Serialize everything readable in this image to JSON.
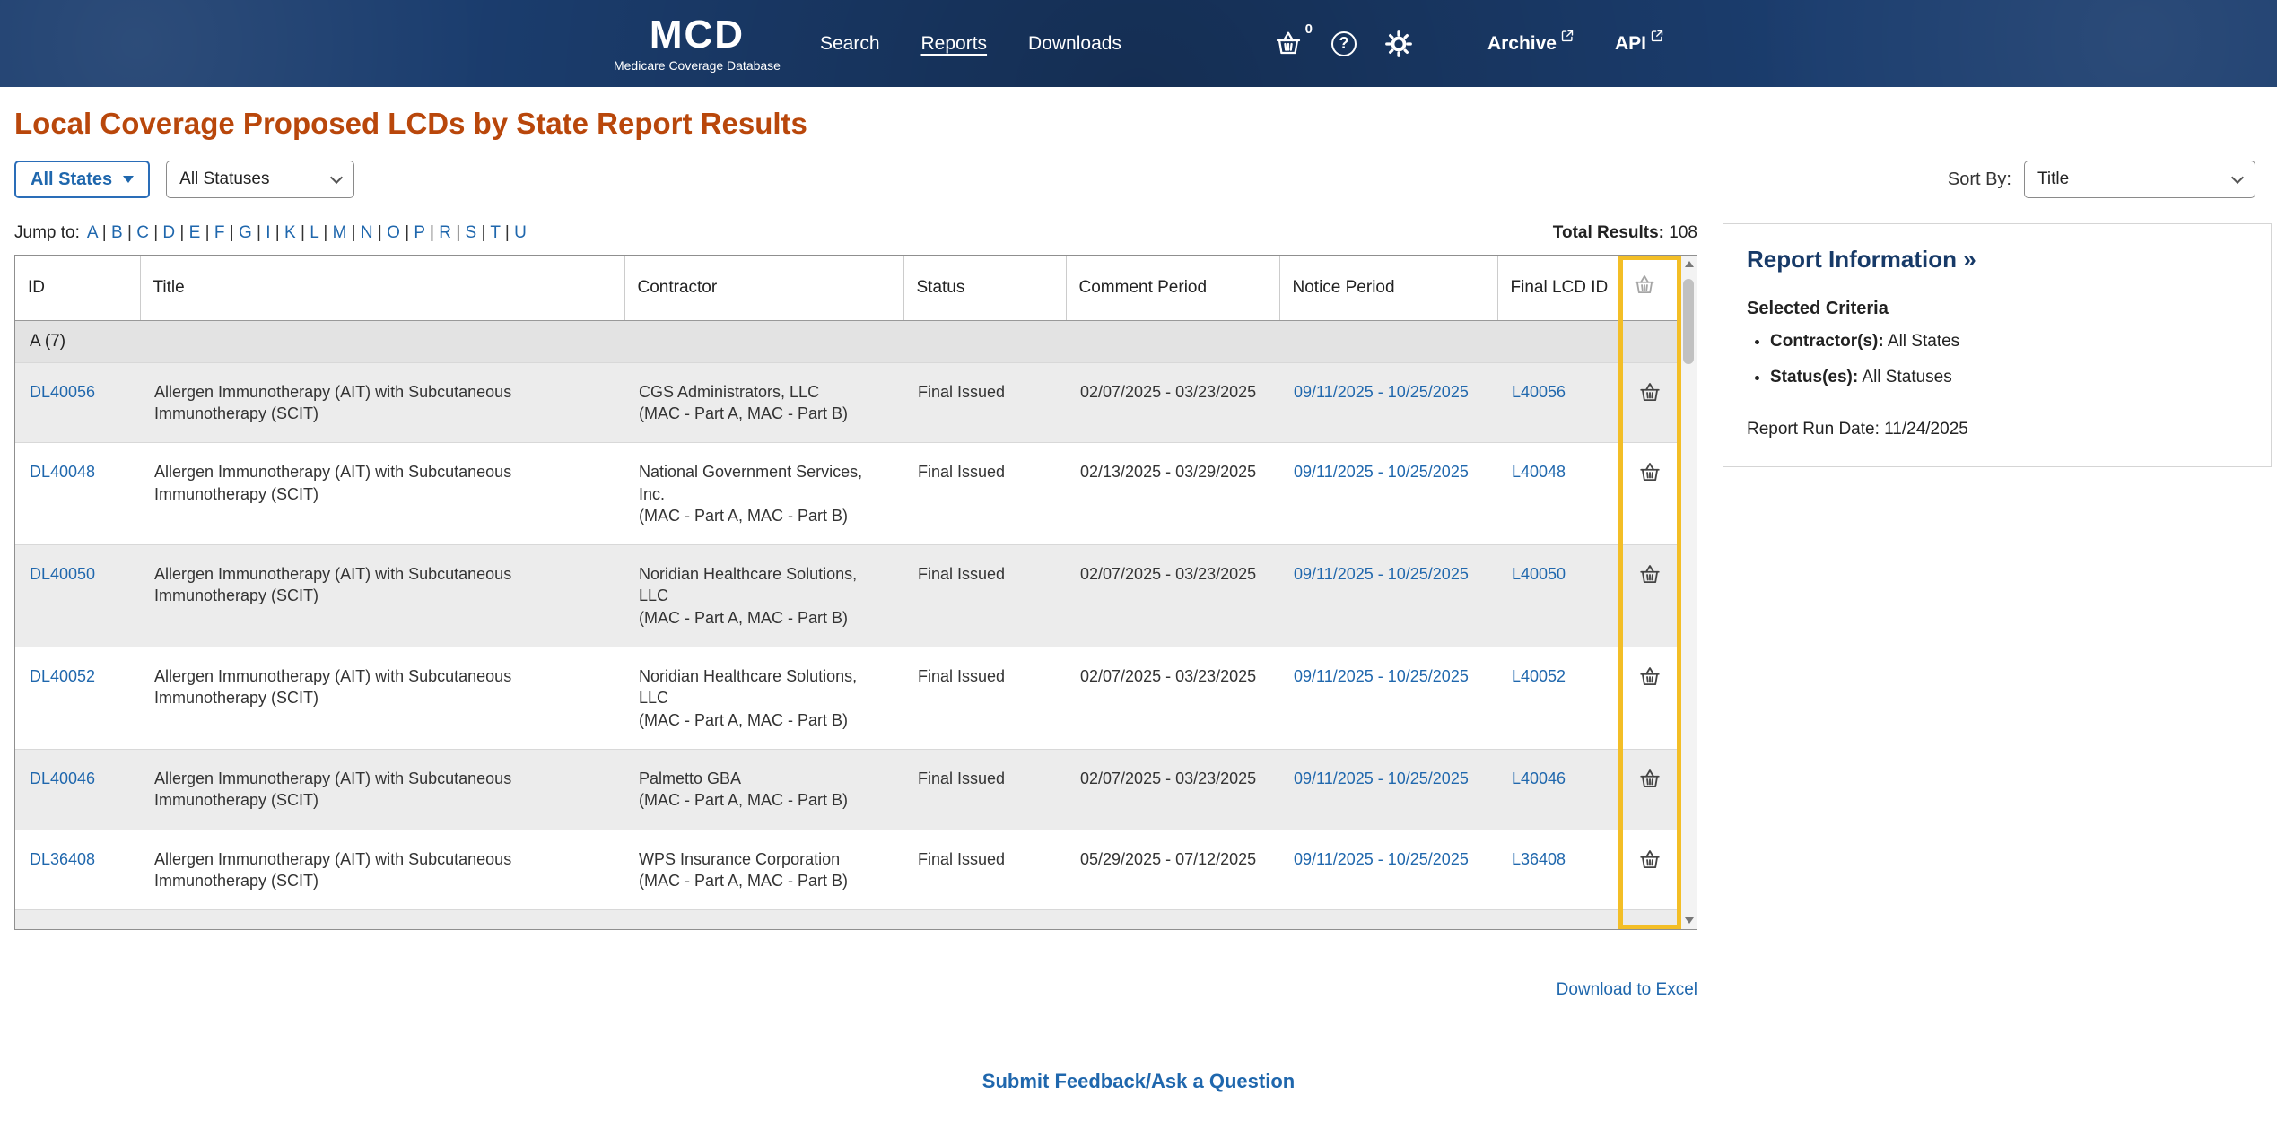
{
  "colors": {
    "header": "#1b3d6e",
    "title": "#b9470b",
    "link": "#1f67ad",
    "highlight": "#f3be26"
  },
  "icons": {
    "help": "?"
  },
  "header": {
    "logo_title": "MCD",
    "logo_subtitle": "Medicare Coverage Database",
    "nav": {
      "search": "Search",
      "reports": "Reports",
      "downloads": "Downloads"
    },
    "basket_count": "0",
    "archive": "Archive",
    "api": "API"
  },
  "page_title": "Local Coverage Proposed LCDs by State Report Results",
  "filters": {
    "states": "All States",
    "statuses": "All Statuses",
    "sort_by_label": "Sort By:",
    "sort_by_value": "Title"
  },
  "jump": {
    "label": "Jump to:",
    "letters": [
      "A",
      "B",
      "C",
      "D",
      "E",
      "F",
      "G",
      "I",
      "K",
      "L",
      "M",
      "N",
      "O",
      "P",
      "R",
      "S",
      "T",
      "U"
    ]
  },
  "totals": {
    "label": "Total Results:",
    "value": "108"
  },
  "table": {
    "headers": {
      "id": "ID",
      "title": "Title",
      "contractor": "Contractor",
      "status": "Status",
      "comment": "Comment Period",
      "notice": "Notice Period",
      "final": "Final LCD ID"
    },
    "group": "A (7)",
    "rows": [
      {
        "id": "DL40056",
        "title": "Allergen Immunotherapy (AIT) with Subcutaneous Immunotherapy (SCIT)",
        "contractor": "CGS Administrators, LLC",
        "contractor_mac": "(MAC - Part A, MAC - Part B)",
        "status": "Final Issued",
        "comment": "02/07/2025 - 03/23/2025",
        "notice": "09/11/2025 - 10/25/2025",
        "final_lcd": "L40056"
      },
      {
        "id": "DL40048",
        "title": "Allergen Immunotherapy (AIT) with Subcutaneous Immunotherapy (SCIT)",
        "contractor": "National Government Services, Inc.",
        "contractor_mac": "(MAC - Part A, MAC - Part B)",
        "status": "Final Issued",
        "comment": "02/13/2025 - 03/29/2025",
        "notice": "09/11/2025 - 10/25/2025",
        "final_lcd": "L40048"
      },
      {
        "id": "DL40050",
        "title": "Allergen Immunotherapy (AIT) with Subcutaneous Immunotherapy (SCIT)",
        "contractor": "Noridian Healthcare Solutions, LLC",
        "contractor_mac": "(MAC - Part A, MAC - Part B)",
        "status": "Final Issued",
        "comment": "02/07/2025 - 03/23/2025",
        "notice": "09/11/2025 - 10/25/2025",
        "final_lcd": "L40050"
      },
      {
        "id": "DL40052",
        "title": "Allergen Immunotherapy (AIT) with Subcutaneous Immunotherapy (SCIT)",
        "contractor": "Noridian Healthcare Solutions, LLC",
        "contractor_mac": "(MAC - Part A, MAC - Part B)",
        "status": "Final Issued",
        "comment": "02/07/2025 - 03/23/2025",
        "notice": "09/11/2025 - 10/25/2025",
        "final_lcd": "L40052"
      },
      {
        "id": "DL40046",
        "title": "Allergen Immunotherapy (AIT) with Subcutaneous Immunotherapy (SCIT)",
        "contractor": "Palmetto GBA",
        "contractor_mac": "(MAC - Part A, MAC - Part B)",
        "status": "Final Issued",
        "comment": "02/07/2025 - 03/23/2025",
        "notice": "09/11/2025 - 10/25/2025",
        "final_lcd": "L40046"
      },
      {
        "id": "DL36408",
        "title": "Allergen Immunotherapy (AIT) with Subcutaneous Immunotherapy (SCIT)",
        "contractor": "WPS Insurance Corporation",
        "contractor_mac": "(MAC - Part A, MAC - Part B)",
        "status": "Final Issued",
        "comment": "05/29/2025 - 07/12/2025",
        "notice": "09/11/2025 - 10/25/2025",
        "final_lcd": "L36408"
      }
    ]
  },
  "report_info": {
    "title": "Report Information »",
    "criteria_heading": "Selected Criteria",
    "criteria": [
      {
        "label": "Contractor(s):",
        "value": " All States"
      },
      {
        "label": "Status(es):",
        "value": " All Statuses"
      }
    ],
    "run_date_label": "Report Run Date: ",
    "run_date_value": "11/24/2025"
  },
  "links": {
    "download": "Download to Excel",
    "feedback": "Submit Feedback/Ask a Question"
  }
}
